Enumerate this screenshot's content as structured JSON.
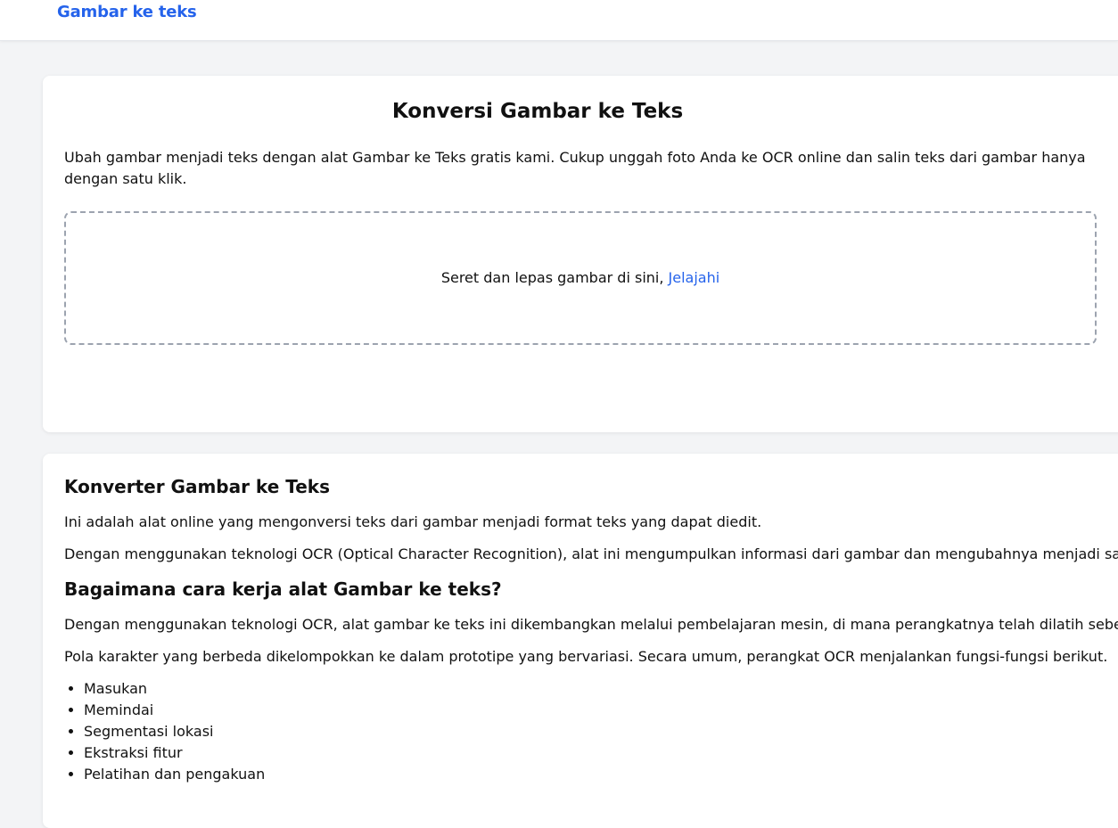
{
  "header": {
    "brand": "Gambar ke teks"
  },
  "tool": {
    "title": "Konversi Gambar ke Teks",
    "description": "Ubah gambar menjadi teks dengan alat Gambar ke Teks gratis kami. Cukup unggah foto Anda ke OCR online dan salin teks dari gambar hanya dengan satu klik.",
    "dropzone_text": "Seret dan lepas gambar di sini, ",
    "browse_label": "Jelajahi"
  },
  "info": {
    "heading1": "Konverter Gambar ke Teks",
    "para1": "Ini adalah alat online yang mengonversi teks dari gambar menjadi format teks yang dapat diedit.",
    "para2": "Dengan menggunakan teknologi OCR (Optical Character Recognition), alat ini mengumpulkan informasi dari gambar dan mengubahnya menjadi salinan d",
    "heading2": "Bagaimana cara kerja alat Gambar ke teks?",
    "para3": "Dengan menggunakan teknologi OCR, alat gambar ke teks ini dikembangkan melalui pembelajaran mesin, di mana perangkatnya telah dilatih sebelumnya",
    "para4": "Pola karakter yang berbeda dikelompokkan ke dalam prototipe yang bervariasi. Secara umum, perangkat OCR menjalankan fungsi-fungsi berikut.",
    "list": [
      "Masukan",
      "Memindai",
      "Segmentasi lokasi",
      "Ekstraksi fitur",
      "Pelatihan dan pengakuan"
    ]
  },
  "colors": {
    "accent": "#2563eb",
    "background": "#f3f4f6",
    "card": "#ffffff",
    "dropzone_border": "#9ca3af"
  }
}
